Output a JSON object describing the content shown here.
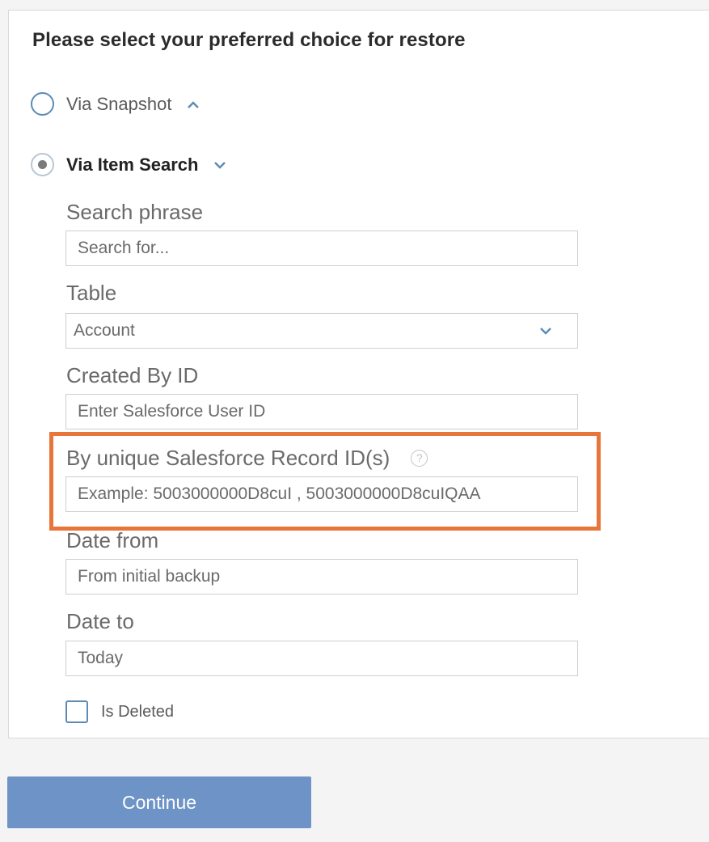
{
  "title": "Please select your preferred choice for restore",
  "options": {
    "snapshot": {
      "label": "Via Snapshot",
      "checked": false,
      "chevron": "chevron-up-icon"
    },
    "item_search": {
      "label": "Via Item Search",
      "checked": true,
      "chevron": "chevron-down-icon"
    }
  },
  "form": {
    "search_phrase": {
      "label": "Search phrase",
      "placeholder": "Search for..."
    },
    "table": {
      "label": "Table",
      "value": "Account"
    },
    "created_by": {
      "label": "Created By ID",
      "placeholder": "Enter Salesforce User ID"
    },
    "record_ids": {
      "label": "By unique Salesforce Record ID(s)",
      "help": "?",
      "placeholder": "Example: 5003000000D8cuI , 5003000000D8cuIQAA"
    },
    "date_from": {
      "label": "Date from",
      "placeholder": "From initial backup"
    },
    "date_to": {
      "label": "Date to",
      "placeholder": "Today"
    },
    "is_deleted": {
      "label": "Is Deleted",
      "checked": false
    }
  },
  "continue_label": "Continue",
  "colors": {
    "accent": "#5b8bb5",
    "highlight": "#e8763a",
    "button": "#6e93c6"
  }
}
